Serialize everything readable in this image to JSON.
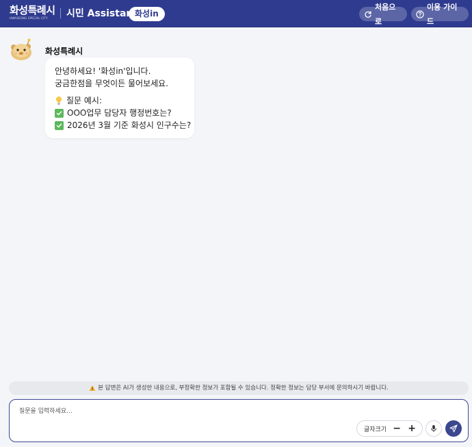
{
  "header": {
    "logo_text": "화성특례시",
    "logo_sub": "HWASEONG SPECIAL CITY",
    "title": "시민 Assistant",
    "badge": "화성in",
    "restart_label": "처음으로",
    "guide_label": "이용 가이드"
  },
  "chat": {
    "bot_name": "화성특례시",
    "message": {
      "line1": "안녕하세요! '화성in'입니다.",
      "line2": "궁금한점을 무엇이든 물어보세요.",
      "examples_title": "질문 예시:",
      "examples": [
        "OOO업무 담당자 행정번호는?",
        "2026년 3월 기준 화성시 인구수는?"
      ]
    }
  },
  "disclaimer": "본 답변은 AI가 생성한 내용으로, 부정확한 정보가 포함될 수 있습니다. 정확한 정보는 담당 부서에 문의하시기 바랍니다.",
  "input": {
    "placeholder": "질문을 입력하세요...",
    "font_size_label": "글자크기",
    "decrease_label": "−",
    "increase_label": "+"
  },
  "colors": {
    "header": "#2f3b8f",
    "accent": "#3b478f",
    "check": "#5cb85c",
    "background": "#f4f5f8"
  },
  "icons": [
    "refresh-icon",
    "help-icon",
    "bulb-icon",
    "check-icon",
    "warning-icon",
    "mic-icon",
    "send-icon"
  ]
}
